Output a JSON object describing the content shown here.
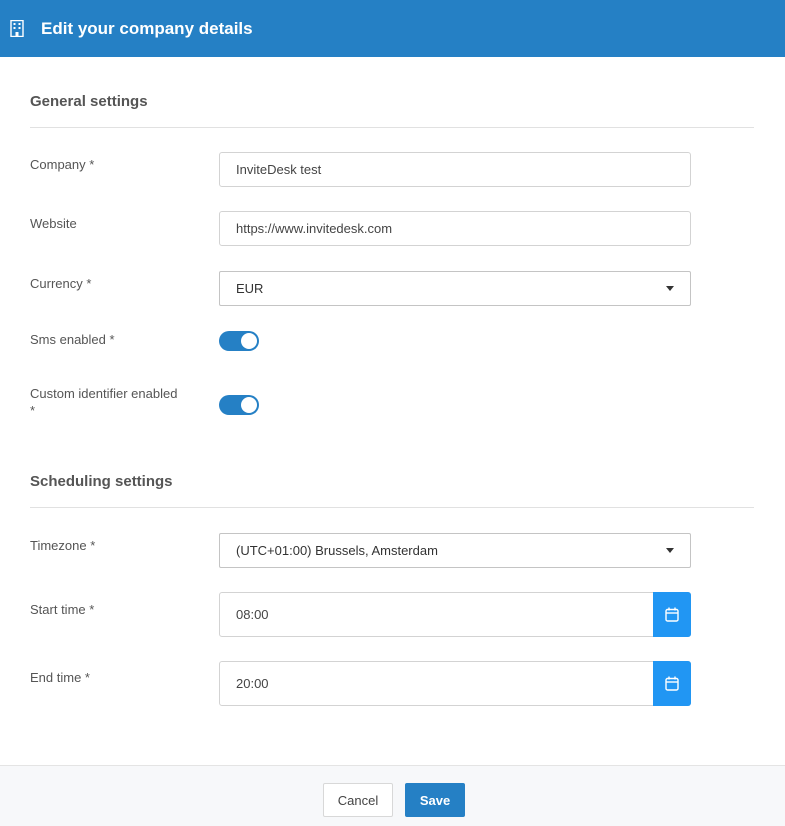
{
  "header": {
    "title": "Edit your company details",
    "icon": "building-icon"
  },
  "general": {
    "title": "General settings",
    "company": {
      "label": "Company *",
      "value": "InviteDesk test"
    },
    "website": {
      "label": "Website",
      "value": "https://www.invitedesk.com"
    },
    "currency": {
      "label": "Currency *",
      "value": "EUR"
    },
    "sms": {
      "label": "Sms enabled *",
      "enabled": true
    },
    "custom_identifier": {
      "label_line1": "Custom identifier enabled",
      "label_line2": "*",
      "enabled": true
    }
  },
  "scheduling": {
    "title": "Scheduling settings",
    "timezone": {
      "label": "Timezone *",
      "value": "(UTC+01:00) Brussels, Amsterdam"
    },
    "start_time": {
      "label": "Start time *",
      "value": "08:00"
    },
    "end_time": {
      "label": "End time *",
      "value": "20:00"
    }
  },
  "footer": {
    "cancel_label": "Cancel",
    "save_label": "Save"
  },
  "colors": {
    "accent": "#2580c5",
    "calendar_button": "#2196f3"
  }
}
